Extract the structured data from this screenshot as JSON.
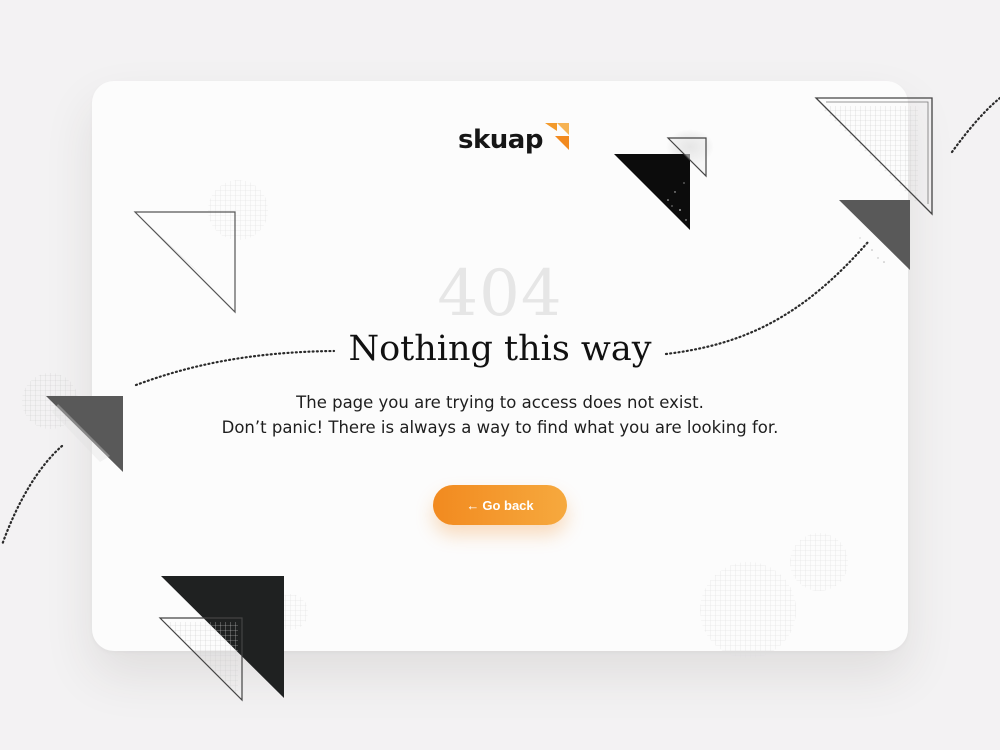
{
  "brand": {
    "name": "skuap",
    "accent_color": "#f39a2c"
  },
  "error": {
    "code": "404",
    "title": "Nothing this way",
    "description_lines": [
      "The page you are trying to access does not exist.",
      "Don’t panic! There is always a way to find what you are looking for."
    ]
  },
  "actions": {
    "back_arrow_icon": "arrow-left-icon",
    "back_arrow_glyph": "←",
    "back_label": "Go back"
  },
  "colors": {
    "page_background": "#f3f2f3",
    "card_background": "#fcfcfc",
    "button_gradient_start": "#f28a1f",
    "button_gradient_end": "#f6a93e",
    "code_color": "#e6e6e6",
    "text_color": "#111111",
    "shape_dark": "#1f2121",
    "shape_gray": "#595959"
  }
}
